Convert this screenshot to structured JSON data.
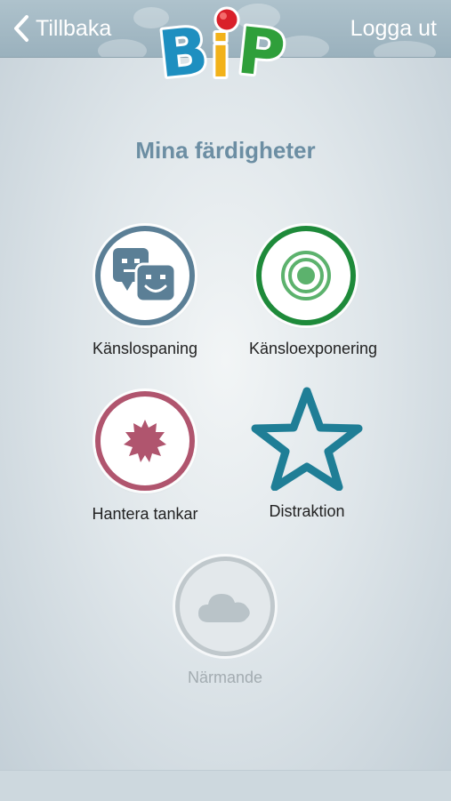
{
  "nav": {
    "back_label": "Tillbaka",
    "logout_label": "Logga ut",
    "logo_text": "BiP"
  },
  "page": {
    "title": "Mina färdigheter"
  },
  "skills": [
    {
      "label": "Känslospaning",
      "icon": "theater-masks-icon",
      "color": "#5b7f96",
      "enabled": true
    },
    {
      "label": "Känsloexponering",
      "icon": "target-icon",
      "color": "#1e8a3a",
      "enabled": true
    },
    {
      "label": "Hantera tankar",
      "icon": "burst-icon",
      "color": "#b0556e",
      "enabled": true
    },
    {
      "label": "Distraktion",
      "icon": "star-icon",
      "color": "#1f7e96",
      "enabled": true
    },
    {
      "label": "Närmande",
      "icon": "cloud-icon",
      "color": "#a9b3b8",
      "enabled": false
    }
  ]
}
